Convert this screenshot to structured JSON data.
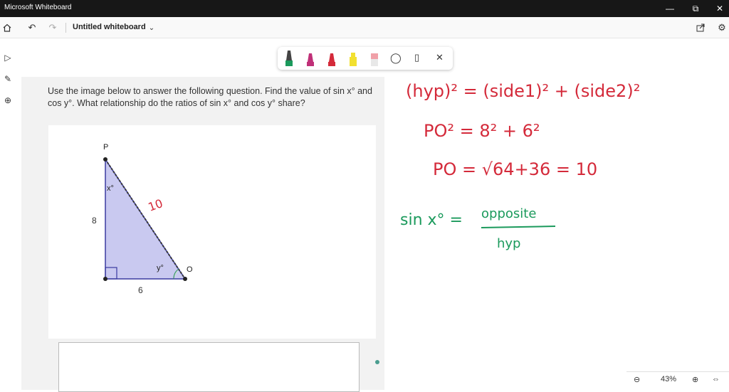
{
  "window": {
    "title": "Microsoft Whiteboard"
  },
  "appbar": {
    "doc_title": "Untitled whiteboard"
  },
  "question": "Use the image below to answer the following question. Find the value of sin x° and cos y°. What relationship do the ratios of sin x° and cos y° share?",
  "figure": {
    "vertex_p": "P",
    "vertex_o": "O",
    "angle_x": "x°",
    "angle_y": "y°",
    "side_vertical": "8",
    "side_horizontal": "6",
    "hypotenuse_ink": "10"
  },
  "ink": {
    "line1": "(hyp)² = (side1)² + (side2)²",
    "line2": "PO² = 8² + 6²",
    "line3": "PO = √64+36 = 10",
    "line4_left": "sin x° =",
    "line4_num": "opposite",
    "line4_den": "hyp"
  },
  "zoom": {
    "level": "43%"
  },
  "colors": {
    "ink_red": "#d42a3a",
    "ink_green": "#1b9a5c",
    "triangle_fill": "#c9c9f0",
    "triangle_edge": "#3a3aa0"
  }
}
